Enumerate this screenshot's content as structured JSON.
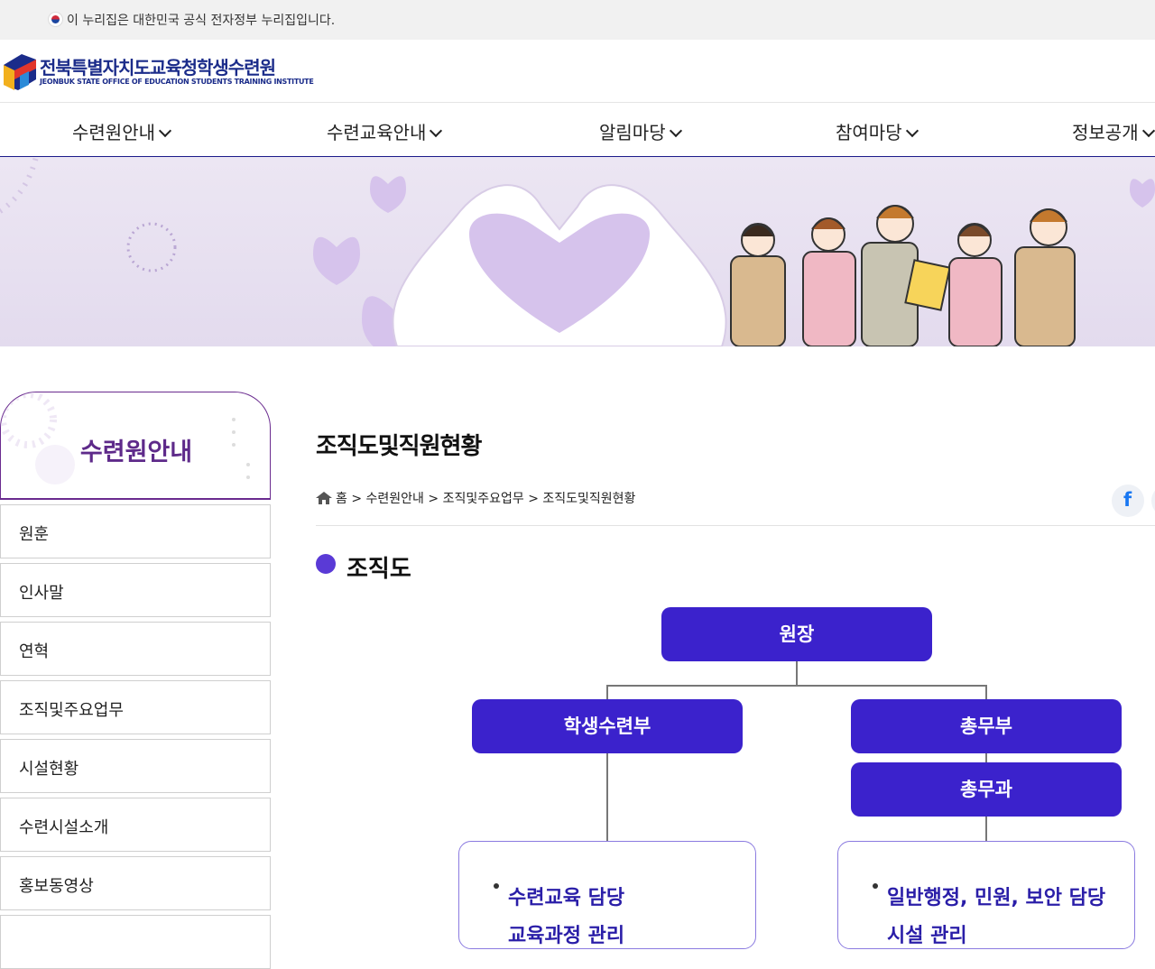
{
  "gov_notice": "이 누리집은 대한민국 공식 전자정부 누리집입니다.",
  "logo": {
    "title": "전북특별자치도교육청학생수련원",
    "subtitle": "JEONBUK STATE OFFICE OF EDUCATION STUDENTS TRAINING INSTITUTE"
  },
  "gnb": [
    "수련원안내",
    "수련교육안내",
    "알림마당",
    "참여마당",
    "정보공개"
  ],
  "lnb": {
    "title": "수련원안내",
    "items": [
      "원훈",
      "인사말",
      "연혁",
      "조직및주요업무",
      "시설현황",
      "수련시설소개",
      "홍보동영상"
    ]
  },
  "page": {
    "title": "조직도및직원현황",
    "breadcrumb": [
      "홈",
      "수련원안내",
      "조직및주요업무",
      "조직도및직원현황"
    ],
    "separator": ">",
    "section_title": "조직도"
  },
  "org": {
    "director": "원장",
    "left_dept": "학생수련부",
    "right_dept": "총무부",
    "right_sub": "총무과",
    "left_duty": [
      "수련교육 담당",
      "교육과정 관리"
    ],
    "right_duty": [
      "일반행정, 민원, 보안 담당",
      "시설 관리"
    ]
  },
  "colors": {
    "primary": "#3b22cc",
    "brand_navy": "#1b2c8a",
    "lnb_purple": "#5e2a8a",
    "banner_bg": "#e3dbee"
  },
  "icons": {
    "home": "home-icon",
    "facebook": "facebook-icon",
    "chevron": "chevron-down-icon"
  }
}
